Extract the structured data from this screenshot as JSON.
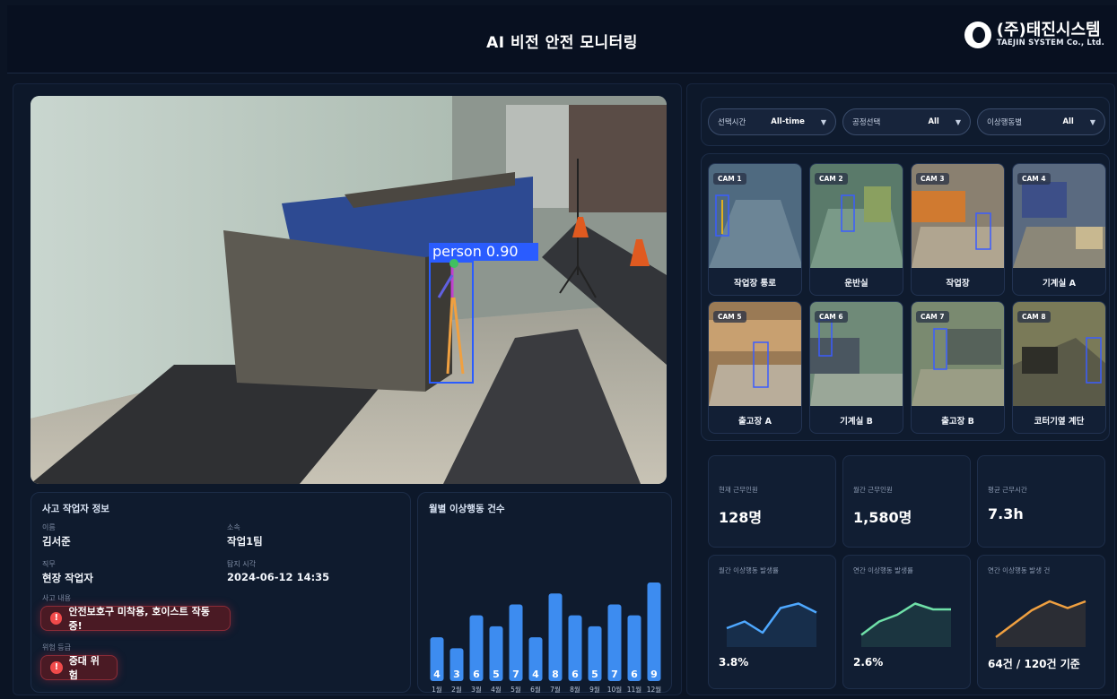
{
  "header": {
    "title": "AI 비전 안전 모니터링",
    "logo_name": "(주)태진시스템",
    "logo_sub": "TAEJIN SYSTEM Co., Ltd."
  },
  "main_camera": {
    "detection_label": "person 0.90"
  },
  "worker": {
    "title": "사고 작업자 정보",
    "name_label": "이름",
    "name": "김서준",
    "dept_label": "소속",
    "dept": "작업1팀",
    "role_label": "직무",
    "role": "현장 작업자",
    "time_label": "탐지 시각",
    "time": "2024-06-12 14:35",
    "incident_label": "사고 내용",
    "incident": "안전보호구 미착용, 호이스트 작동 중!",
    "risk_label": "위험 등급",
    "risk": "중대 위험",
    "alert_icon": "!"
  },
  "chart_data": {
    "type": "bar",
    "title": "월별 이상행동 건수",
    "categories": [
      "1월",
      "2월",
      "3월",
      "4월",
      "5월",
      "6월",
      "7월",
      "8월",
      "9월",
      "10월",
      "11월",
      "12월"
    ],
    "values": [
      4,
      3,
      6,
      5,
      7,
      4,
      8,
      6,
      5,
      7,
      6,
      9
    ],
    "ylim": [
      0,
      9
    ],
    "color": "#3d8cf0"
  },
  "filters": [
    {
      "label": "선택시간",
      "value": "All-time",
      "arrow": "▼"
    },
    {
      "label": "공정선택",
      "value": "All",
      "arrow": "▼"
    },
    {
      "label": "이상행동별",
      "value": "All",
      "arrow": "▼"
    }
  ],
  "cameras": [
    {
      "tag": "CAM 1",
      "name": "작업장 통로"
    },
    {
      "tag": "CAM 2",
      "name": "운반실"
    },
    {
      "tag": "CAM 3",
      "name": "작업장"
    },
    {
      "tag": "CAM 4",
      "name": "기계실 A"
    },
    {
      "tag": "CAM 5",
      "name": "출고장 A"
    },
    {
      "tag": "CAM 6",
      "name": "기계실 B"
    },
    {
      "tag": "CAM 7",
      "name": "출고장 B"
    },
    {
      "tag": "CAM 8",
      "name": "코터기옆 계단"
    }
  ],
  "stats": [
    {
      "label": "현재 근무인원",
      "value": "128명"
    },
    {
      "label": "월간 근무인원",
      "value": "1,580명"
    },
    {
      "label": "평균 근무시간",
      "value": "7.3h"
    }
  ],
  "trends": [
    {
      "label": "월간 이상행동 발생률",
      "value": "3.8%",
      "color": "#4ea8ff",
      "points": [
        0.3,
        0.45,
        0.2,
        0.75,
        0.85,
        0.65
      ]
    },
    {
      "label": "연간 이상행동 발생률",
      "value": "2.6%",
      "color": "#6fe0a8",
      "points": [
        0.15,
        0.45,
        0.6,
        0.85,
        0.72,
        0.72
      ]
    },
    {
      "label": "연간 이상행동 발생 건",
      "value": "64건 / 120건 기준",
      "color": "#f0a040",
      "points": [
        0.1,
        0.4,
        0.7,
        0.9,
        0.75,
        0.9
      ]
    }
  ],
  "colors": {
    "accent": "#3d8cf0",
    "danger": "#f04a4a",
    "bg": "#0b1424"
  }
}
